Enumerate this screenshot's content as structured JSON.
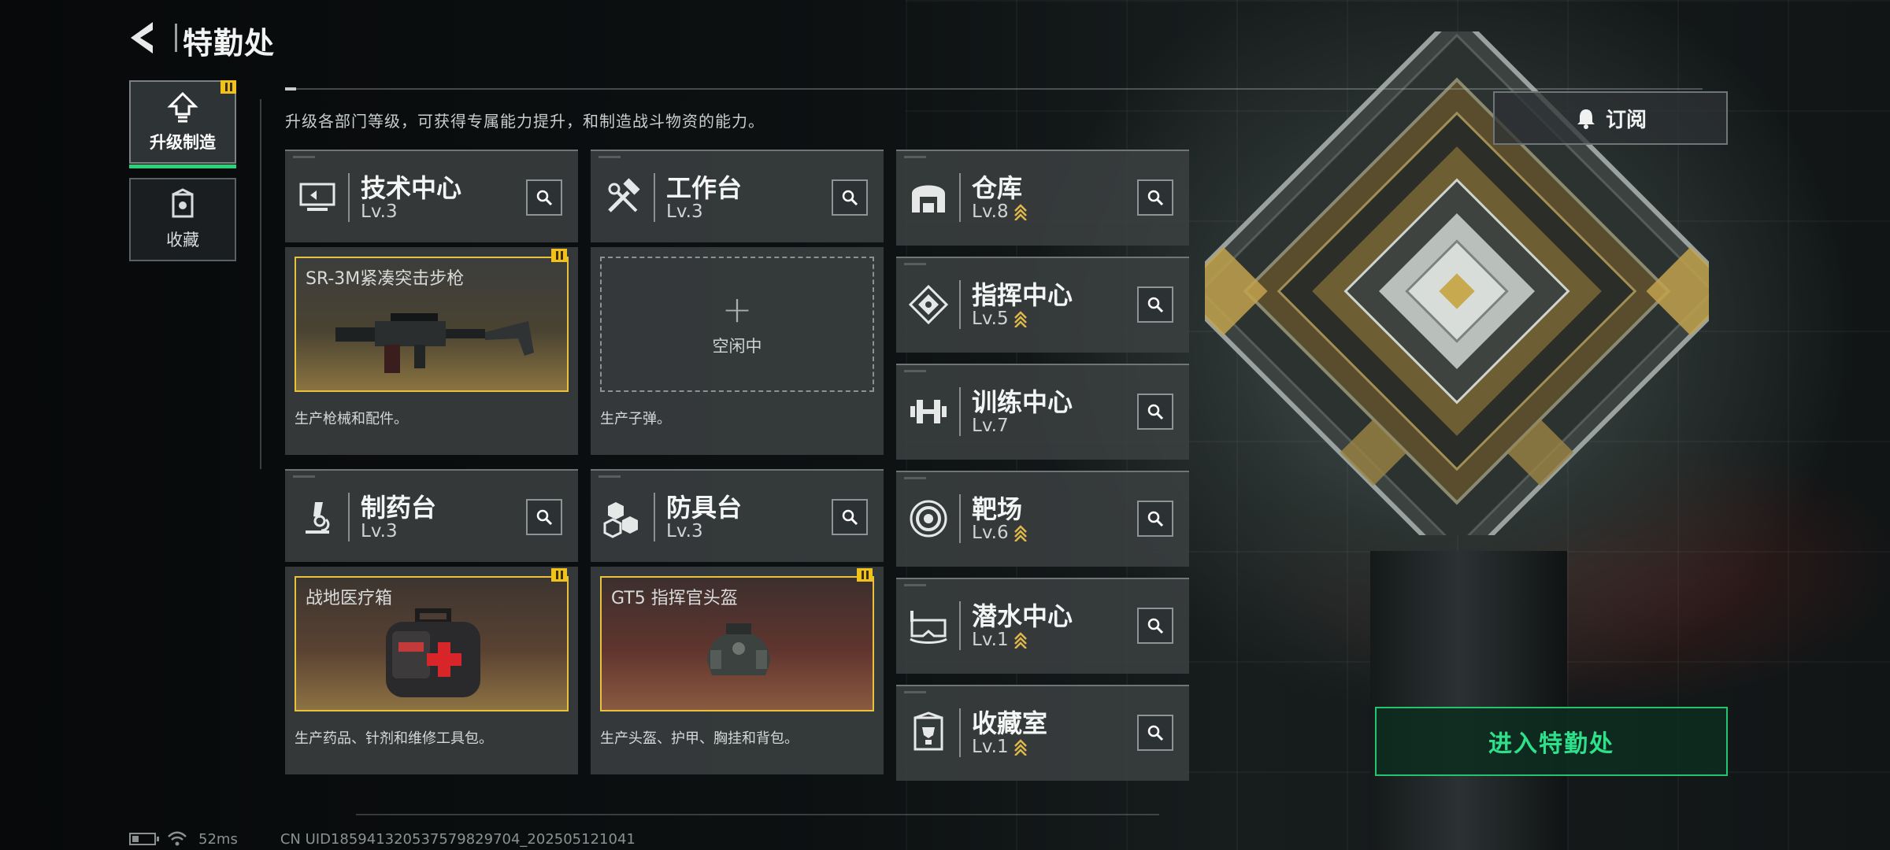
{
  "header": {
    "title": "特勤处"
  },
  "tabs": [
    {
      "label": "升级制造",
      "icon": "upgrade-icon",
      "active": true,
      "badge": true
    },
    {
      "label": "收藏",
      "icon": "collection-icon",
      "active": false,
      "badge": false
    }
  ],
  "description": "升级各部门等级，可获得专属能力提升，和制造战斗物资的能力。",
  "facilities_large": [
    {
      "name": "技术中心",
      "level": "Lv.3",
      "icon": "monitor-icon",
      "slot": {
        "title": "SR-3M紧凑突击步枪",
        "state": "producing",
        "badge": true,
        "item_icon": "rifle-icon"
      },
      "desc": "生产枪械和配件。"
    },
    {
      "name": "工作台",
      "level": "Lv.3",
      "icon": "hammer-wrench-icon",
      "slot": {
        "title": "",
        "state": "idle",
        "idle_label": "空闲中",
        "badge": false
      },
      "desc": "生产子弹。"
    },
    {
      "name": "制药台",
      "level": "Lv.3",
      "icon": "microscope-icon",
      "slot": {
        "title": "战地医疗箱",
        "state": "producing",
        "badge": true,
        "item_icon": "medkit-icon"
      },
      "desc": "生产药品、针剂和维修工具包。"
    },
    {
      "name": "防具台",
      "level": "Lv.3",
      "icon": "cubes-icon",
      "slot": {
        "title": "GT5 指挥官头盔",
        "state": "producing",
        "badge": true,
        "item_icon": "helmet-icon"
      },
      "desc": "生产头盔、护甲、胸挂和背包。"
    }
  ],
  "facilities_small": [
    {
      "name": "仓库",
      "level": "Lv.8",
      "icon": "warehouse-icon",
      "upgradable": true
    },
    {
      "name": "指挥中心",
      "level": "Lv.5",
      "icon": "command-icon",
      "upgradable": true
    },
    {
      "name": "训练中心",
      "level": "Lv.7",
      "icon": "dumbbell-icon",
      "upgradable": false
    },
    {
      "name": "靶场",
      "level": "Lv.6",
      "icon": "target-icon",
      "upgradable": true
    },
    {
      "name": "潜水中心",
      "level": "Lv.1",
      "icon": "diving-mask-icon",
      "upgradable": true
    },
    {
      "name": "收藏室",
      "level": "Lv.1",
      "icon": "trophy-room-icon",
      "upgradable": true
    }
  ],
  "subscribe": {
    "label": "订阅",
    "icon": "bell-icon"
  },
  "enter_button": {
    "label": "进入特勤处"
  },
  "footer": {
    "ping": "52ms",
    "uid": "CN UID185941320537579829704_202505121041"
  },
  "colors": {
    "accent_green": "#2ee08a",
    "badge_yellow": "#f1c21b",
    "slot_border": "#e8c23c",
    "upgrade_chevron": "#e0b84a"
  }
}
